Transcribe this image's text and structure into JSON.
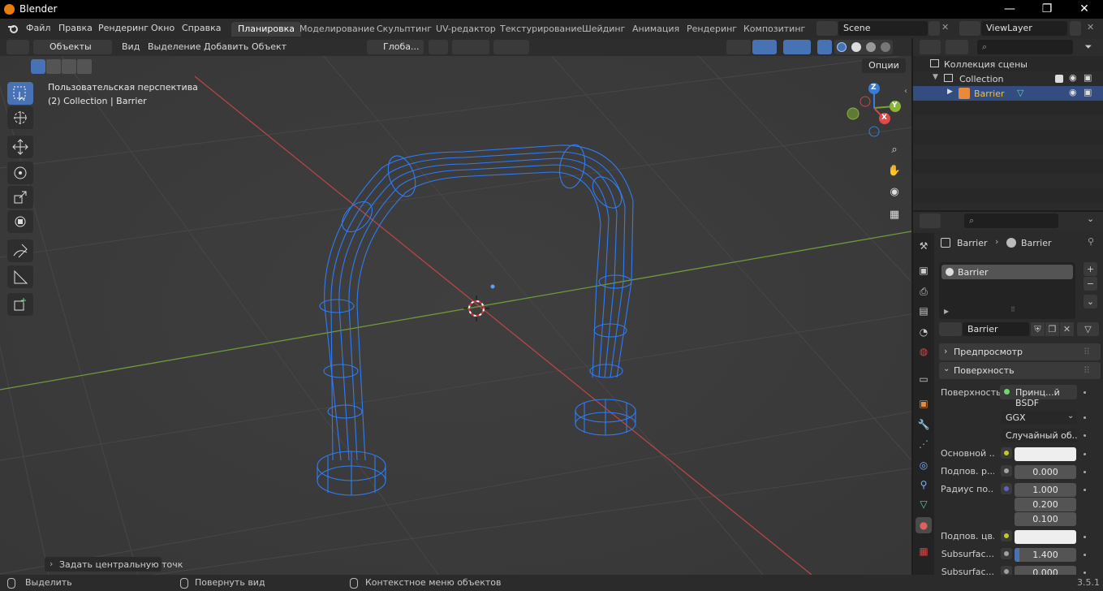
{
  "titlebar": {
    "title": "Blender",
    "minimize": "—",
    "maximize": "❐",
    "close": "✕"
  },
  "menu": {
    "items": [
      "Файл",
      "Правка",
      "Рендеринг",
      "Окно",
      "Справка"
    ]
  },
  "workspaces": [
    "Планировка",
    "Моделирование",
    "Скульптинг",
    "UV-редактор",
    "Текстурирование",
    "Шейдинг",
    "Анимация",
    "Рендеринг",
    "Композитинг"
  ],
  "scene": {
    "name": "Scene",
    "view_layer": "ViewLayer"
  },
  "viewport_header": {
    "mode": "Объекты",
    "menus": [
      "Вид",
      "Выделение",
      "Добавить",
      "Объект"
    ],
    "orientation": "Глоба...",
    "options": "Опции"
  },
  "viewport": {
    "perspective_label": "Пользовательская перспектива",
    "collection_label": "(2) Collection | Barrier",
    "last_operator": "Задать центральную точк",
    "gizmo": {
      "z": "Z",
      "y": "Y",
      "x": "X"
    }
  },
  "outliner": {
    "scene_collection": "Коллекция сцены",
    "collection": "Collection",
    "object": "Barrier"
  },
  "properties": {
    "breadcrumb": {
      "object": "Barrier",
      "material": "Barrier"
    },
    "material_slot": "Barrier",
    "material_name": "Barrier",
    "panels": {
      "preview": "Предпросмотр",
      "surface": "Поверхность"
    },
    "surface_label": "Поверхность",
    "surface_value": "Принц...й BSDF",
    "distribution": "GGX",
    "subsurface_method": "Случайный об...",
    "rows": [
      {
        "label": "Основной ...",
        "value": "",
        "socket": "#c7c729"
      },
      {
        "label": "Подпов. р...",
        "value": "0.000",
        "socket": "#a1a1a1"
      },
      {
        "label": "Радиус по...",
        "value": "1.000",
        "socket": "#6363c7"
      },
      {
        "label": "",
        "value": "0.200",
        "socket": ""
      },
      {
        "label": "",
        "value": "0.100",
        "socket": ""
      },
      {
        "label": "Подпов. цв...",
        "value": "",
        "socket": "#c7c729"
      },
      {
        "label": "Subsurfac...",
        "value": "1.400",
        "socket": "#a1a1a1"
      },
      {
        "label": "Subsurfac...",
        "value": "0.000",
        "socket": "#a1a1a1"
      }
    ]
  },
  "statusbar": {
    "select": "Выделить",
    "rotate": "Повернуть вид",
    "context": "Контекстное меню объектов",
    "version": "3.5.1"
  },
  "colors": {
    "accent": "#4772b3",
    "wire": "#3b82f6",
    "x_axis": "#c44848",
    "y_axis": "#7aa03a"
  }
}
